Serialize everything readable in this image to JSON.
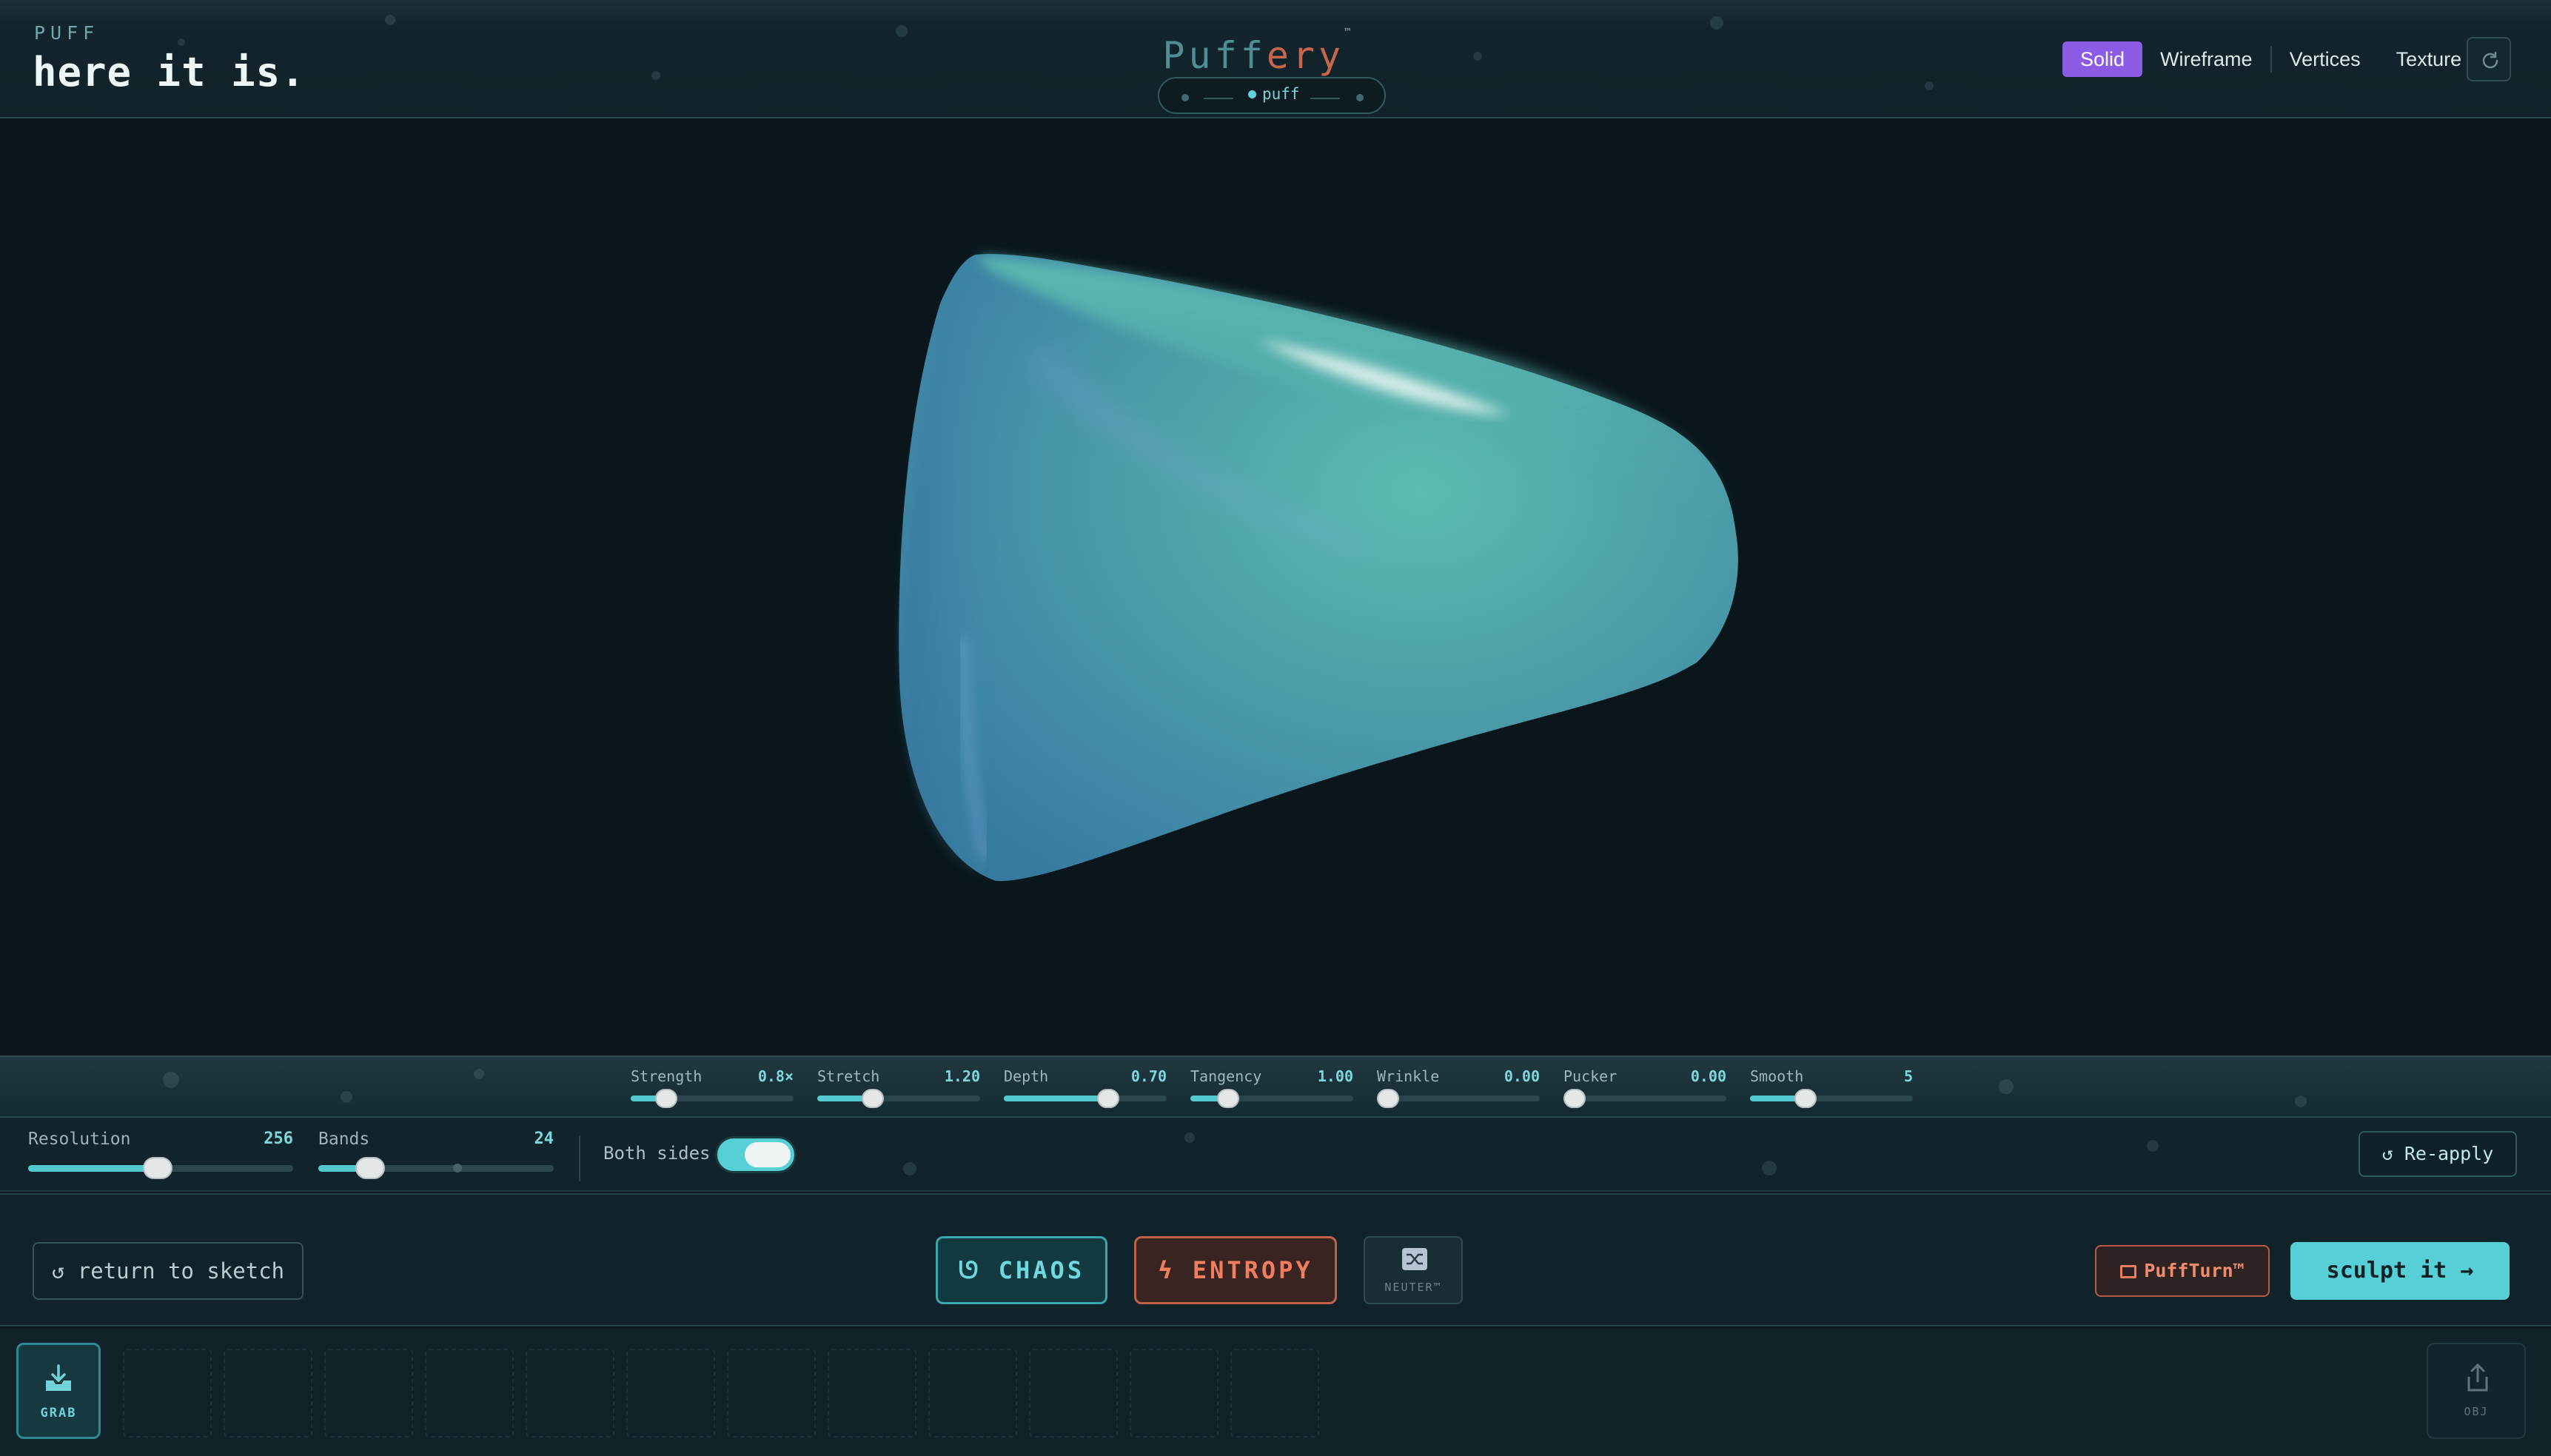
{
  "header": {
    "eyebrow": "PUFF",
    "title": "here it is.",
    "logo_part1": "Puff",
    "logo_part2": "ery",
    "logo_mark": "™",
    "mode_label": "puff"
  },
  "view_tabs": [
    {
      "label": "Solid",
      "active": true
    },
    {
      "label": "Wireframe",
      "active": false
    },
    {
      "label": "Vertices",
      "active": false
    },
    {
      "label": "Texture",
      "active": false
    }
  ],
  "deform_controls": [
    {
      "label": "Strength",
      "value": "0.8×",
      "level": 0.22
    },
    {
      "label": "Stretch",
      "value": "1.20",
      "level": 0.34
    },
    {
      "label": "Depth",
      "value": "0.70",
      "level": 0.64
    },
    {
      "label": "Tangency",
      "value": "1.00",
      "level": 0.23
    },
    {
      "label": "Wrinkle",
      "value": "0.00",
      "level": 0.07
    },
    {
      "label": "Pucker",
      "value": "0.00",
      "level": 0.07
    },
    {
      "label": "Smooth",
      "value": "5",
      "level": 0.34
    }
  ],
  "settings": {
    "resolution": {
      "label": "Resolution",
      "value": "256",
      "level": 0.49
    },
    "bands": {
      "label": "Bands",
      "value": "24",
      "level": 0.22
    },
    "both_sides_label": "Both sides",
    "both_sides_on": true,
    "reapply_label": "Re-apply"
  },
  "actions": {
    "return_label": "return to sketch",
    "chaos_label": "CHAOS",
    "entropy_label": "ENTROPY",
    "neuter_label": "NEUTER™",
    "puffturn_label": "PuffTurn™",
    "sculpt_label": "sculpt it"
  },
  "dock": {
    "grab_label": "GRAB",
    "obj_label": "OBJ"
  },
  "colors": {
    "accent_teal": "#57cfd6",
    "accent_purple": "#8c5ce6",
    "accent_orange": "#f07d5d",
    "mesh_teal": "#4fa9a3",
    "background": "#0a161c"
  }
}
